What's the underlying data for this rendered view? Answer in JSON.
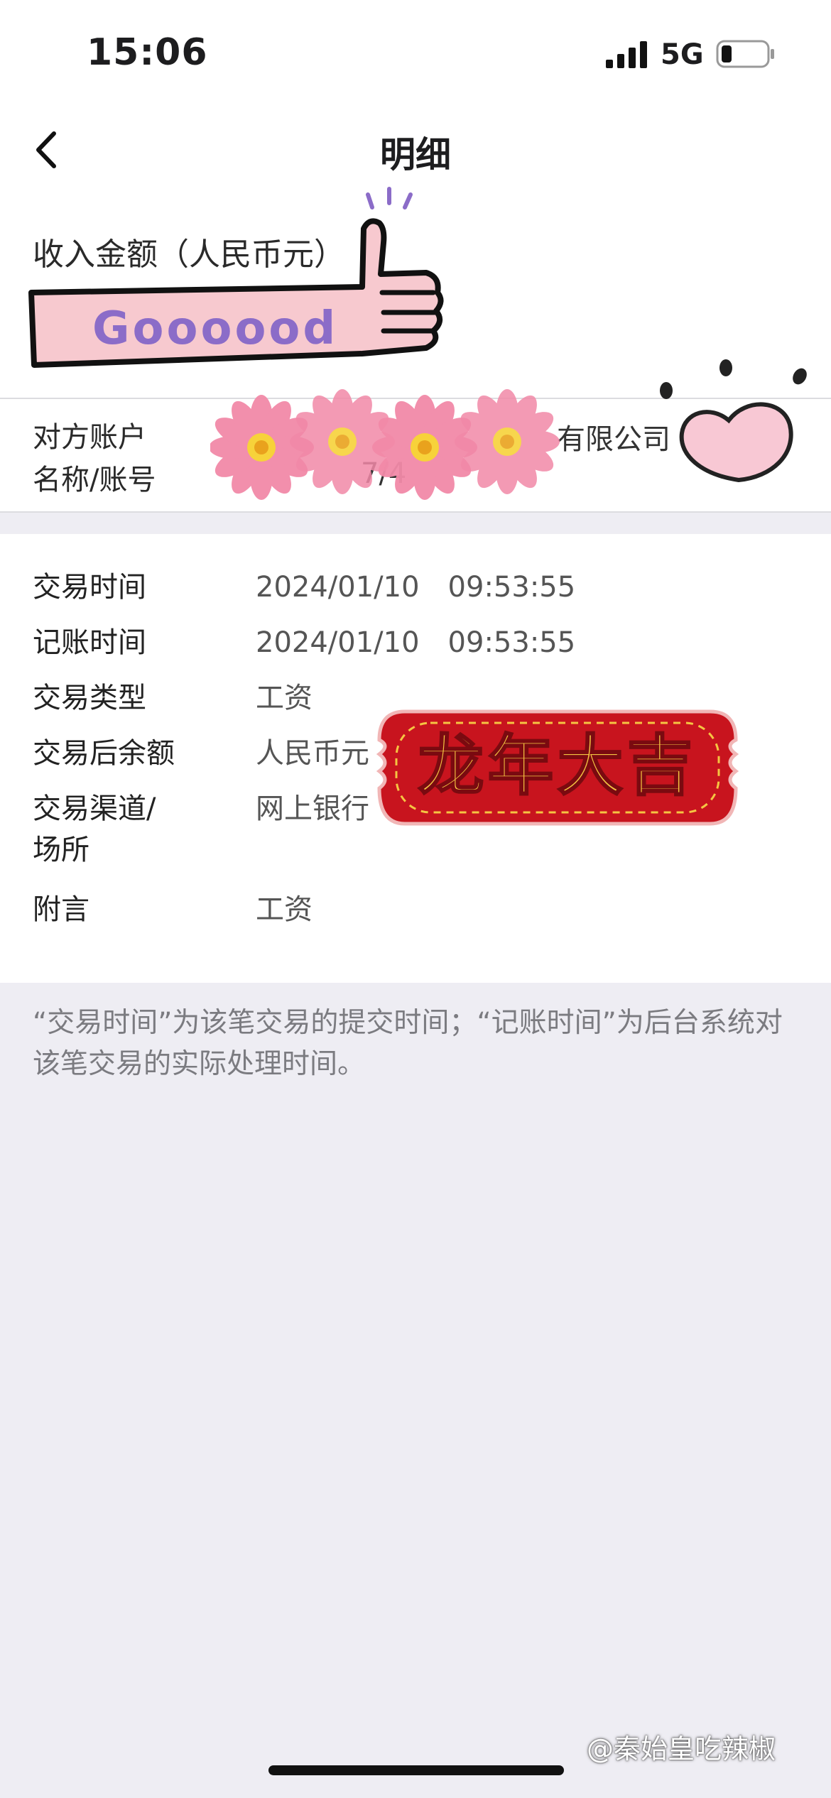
{
  "status_bar": {
    "time": "15:06",
    "network": "5G",
    "icons": [
      "signal-icon",
      "battery-icon"
    ]
  },
  "nav": {
    "title": "明细",
    "back_icon": "chevron-left-icon"
  },
  "amount": {
    "label": "收入金额（人民币元）"
  },
  "counterparty": {
    "label_line1": "对方账户",
    "label_line2": "名称/账号",
    "company_suffix": "有限公司",
    "account_fragment": "7/4"
  },
  "details": {
    "rows": [
      {
        "label": "交易时间",
        "value": "2024/01/10　09:53:55"
      },
      {
        "label": "记账时间",
        "value": "2024/01/10　09:53:55"
      },
      {
        "label": "交易类型",
        "value": "工资"
      },
      {
        "label": "交易后余额",
        "value": "人民币元"
      },
      {
        "label": "交易渠道/\n场所",
        "value": "网上银行"
      },
      {
        "label": "附言",
        "value": "工资"
      }
    ]
  },
  "note": "“交易时间”为该笔交易的提交时间；“记账时间”为后台系统对该笔交易的实际处理时间。",
  "stickers": {
    "thumbs_text": "Goooood",
    "banner_text": "龙年大吉",
    "icons": [
      "thumbs-up-sticker-icon",
      "flower-sticker-icon",
      "heart-sticker-icon",
      "new-year-banner-icon"
    ]
  },
  "watermark": "@秦始皇吃辣椒",
  "colors": {
    "background": "#eeedf3",
    "card": "#ffffff",
    "banner_red": "#c8141e",
    "banner_gold": "#f5c542",
    "thumbs_pink": "#f7c9cf",
    "thumbs_purple": "#8b6cc8"
  }
}
